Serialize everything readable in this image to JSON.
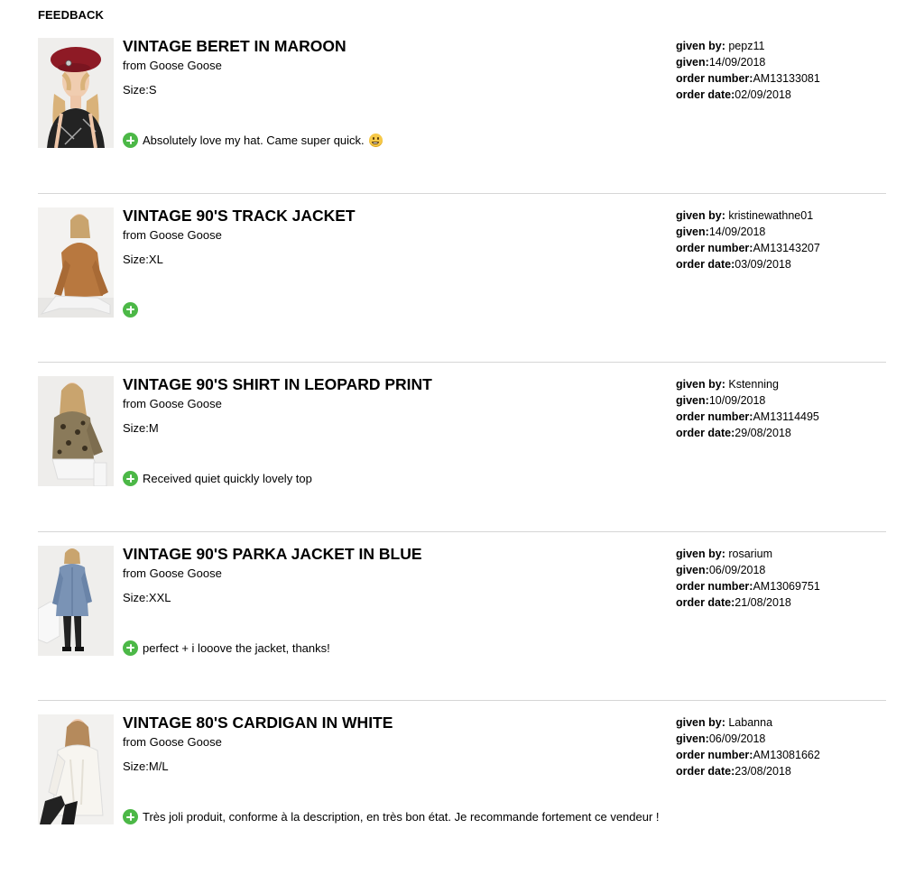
{
  "page_title": "FEEDBACK",
  "feedback": [
    {
      "title": "VINTAGE BERET IN MAROON",
      "seller": "from Goose Goose",
      "size": "Size:S",
      "comment": "Absolutely love my hat. Came super quick.",
      "comment_emoji": "grinning-face-emoji",
      "given_by_label": "given by:",
      "given_by": "pepz11",
      "given_label": "given:",
      "given": "14/09/2018",
      "order_number_label": "order number:",
      "order_number": "AM13133081",
      "order_date_label": "order date:",
      "order_date": "02/09/2018"
    },
    {
      "title": "VINTAGE 90'S TRACK JACKET",
      "seller": "from Goose Goose",
      "size": "Size:XL",
      "comment": "",
      "given_by_label": "given by:",
      "given_by": "kristinewathne01",
      "given_label": "given:",
      "given": "14/09/2018",
      "order_number_label": "order number:",
      "order_number": "AM13143207",
      "order_date_label": "order date:",
      "order_date": "03/09/2018"
    },
    {
      "title": "VINTAGE 90'S SHIRT IN LEOPARD PRINT",
      "seller": "from Goose Goose",
      "size": "Size:M",
      "comment": "Received quiet quickly lovely top",
      "given_by_label": "given by:",
      "given_by": "Kstenning",
      "given_label": "given:",
      "given": "10/09/2018",
      "order_number_label": "order number:",
      "order_number": "AM13114495",
      "order_date_label": "order date:",
      "order_date": "29/08/2018"
    },
    {
      "title": "VINTAGE 90'S PARKA JACKET IN BLUE",
      "seller": "from Goose Goose",
      "size": "Size:XXL",
      "comment": "perfect + i looove the jacket, thanks!",
      "given_by_label": "given by:",
      "given_by": "rosarium",
      "given_label": "given:",
      "given": "06/09/2018",
      "order_number_label": "order number:",
      "order_number": "AM13069751",
      "order_date_label": "order date:",
      "order_date": "21/08/2018"
    },
    {
      "title": "VINTAGE 80'S CARDIGAN IN WHITE",
      "seller": "from Goose Goose",
      "size": "Size:M/L",
      "comment": "Très joli produit, conforme à la description, en très bon état. Je recommande fortement ce vendeur !",
      "given_by_label": "given by:",
      "given_by": "Labanna",
      "given_label": "given:",
      "given": "06/09/2018",
      "order_number_label": "order number:",
      "order_number": "AM13081662",
      "order_date_label": "order date:",
      "order_date": "23/08/2018"
    }
  ],
  "icons": {
    "rating": "positive-rating-plus-icon",
    "emoji": "grinning-face-emoji"
  },
  "colors": {
    "positive_green": "#4cb847",
    "divider": "#d6d6d6"
  }
}
